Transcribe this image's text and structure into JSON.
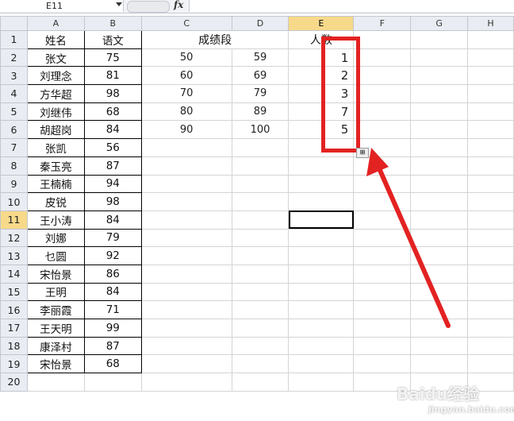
{
  "formula_bar": {
    "name_box": "E11",
    "fx_label": "fx",
    "formula": ""
  },
  "columns": [
    "A",
    "B",
    "C",
    "D",
    "E",
    "F",
    "G",
    "H"
  ],
  "rows": [
    "1",
    "2",
    "3",
    "4",
    "5",
    "6",
    "7",
    "8",
    "9",
    "10",
    "11",
    "12",
    "13",
    "14",
    "15",
    "16",
    "17",
    "18",
    "19",
    "20"
  ],
  "header_row": {
    "a": "姓名",
    "b": "语文",
    "c": "成绩段",
    "e": "人数"
  },
  "students": [
    {
      "name": "张文",
      "score": "75"
    },
    {
      "name": "刘理念",
      "score": "81"
    },
    {
      "name": "方华超",
      "score": "98"
    },
    {
      "name": "刘继伟",
      "score": "68"
    },
    {
      "name": "胡超岗",
      "score": "84"
    },
    {
      "name": "张凯",
      "score": "56"
    },
    {
      "name": "秦玉亮",
      "score": "87"
    },
    {
      "name": "王楠楠",
      "score": "94"
    },
    {
      "name": "皮锐",
      "score": "98"
    },
    {
      "name": "王小涛",
      "score": "84"
    },
    {
      "name": "刘娜",
      "score": "79"
    },
    {
      "name": "乜圆",
      "score": "92"
    },
    {
      "name": "宋怡景",
      "score": "86"
    },
    {
      "name": "王明",
      "score": "84"
    },
    {
      "name": "李丽霞",
      "score": "71"
    },
    {
      "name": "王天明",
      "score": "99"
    },
    {
      "name": "康泽村",
      "score": "87"
    },
    {
      "name": "宋怡景",
      "score": "68"
    }
  ],
  "bands": [
    {
      "low": "50",
      "high": "59",
      "count": "1"
    },
    {
      "low": "60",
      "high": "69",
      "count": "2"
    },
    {
      "low": "70",
      "high": "79",
      "count": "3"
    },
    {
      "low": "80",
      "high": "89",
      "count": "7"
    },
    {
      "low": "90",
      "high": "100",
      "count": "5"
    }
  ],
  "selected_cell": "E11",
  "colors": {
    "highlight_red": "#e32222",
    "selected_header": "#f7d98a"
  },
  "watermark": {
    "main": "Baidu经验",
    "sub": "jingyan.baidu.com"
  }
}
